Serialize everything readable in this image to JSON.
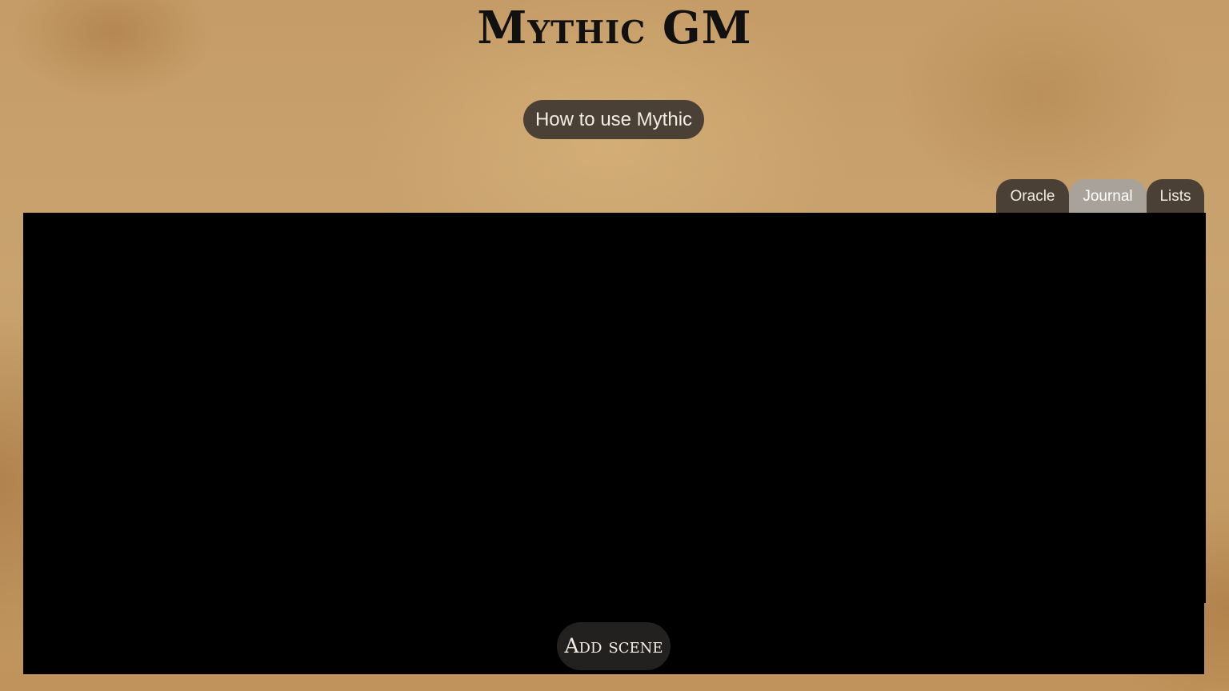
{
  "header": {
    "title": "Mythic GM",
    "help_button": "How to use Mythic"
  },
  "tabs": [
    {
      "label": "Oracle",
      "active": false
    },
    {
      "label": "Journal",
      "active": true
    },
    {
      "label": "Lists",
      "active": false
    }
  ],
  "journal": {
    "add_scene_label": "Add scene"
  },
  "colors": {
    "parchment": "#c29a63",
    "button_bg": "#4a4036",
    "active_tab_bg": "#a8a29b",
    "panel_bg": "#000000",
    "add_scene_bg": "#232120"
  }
}
